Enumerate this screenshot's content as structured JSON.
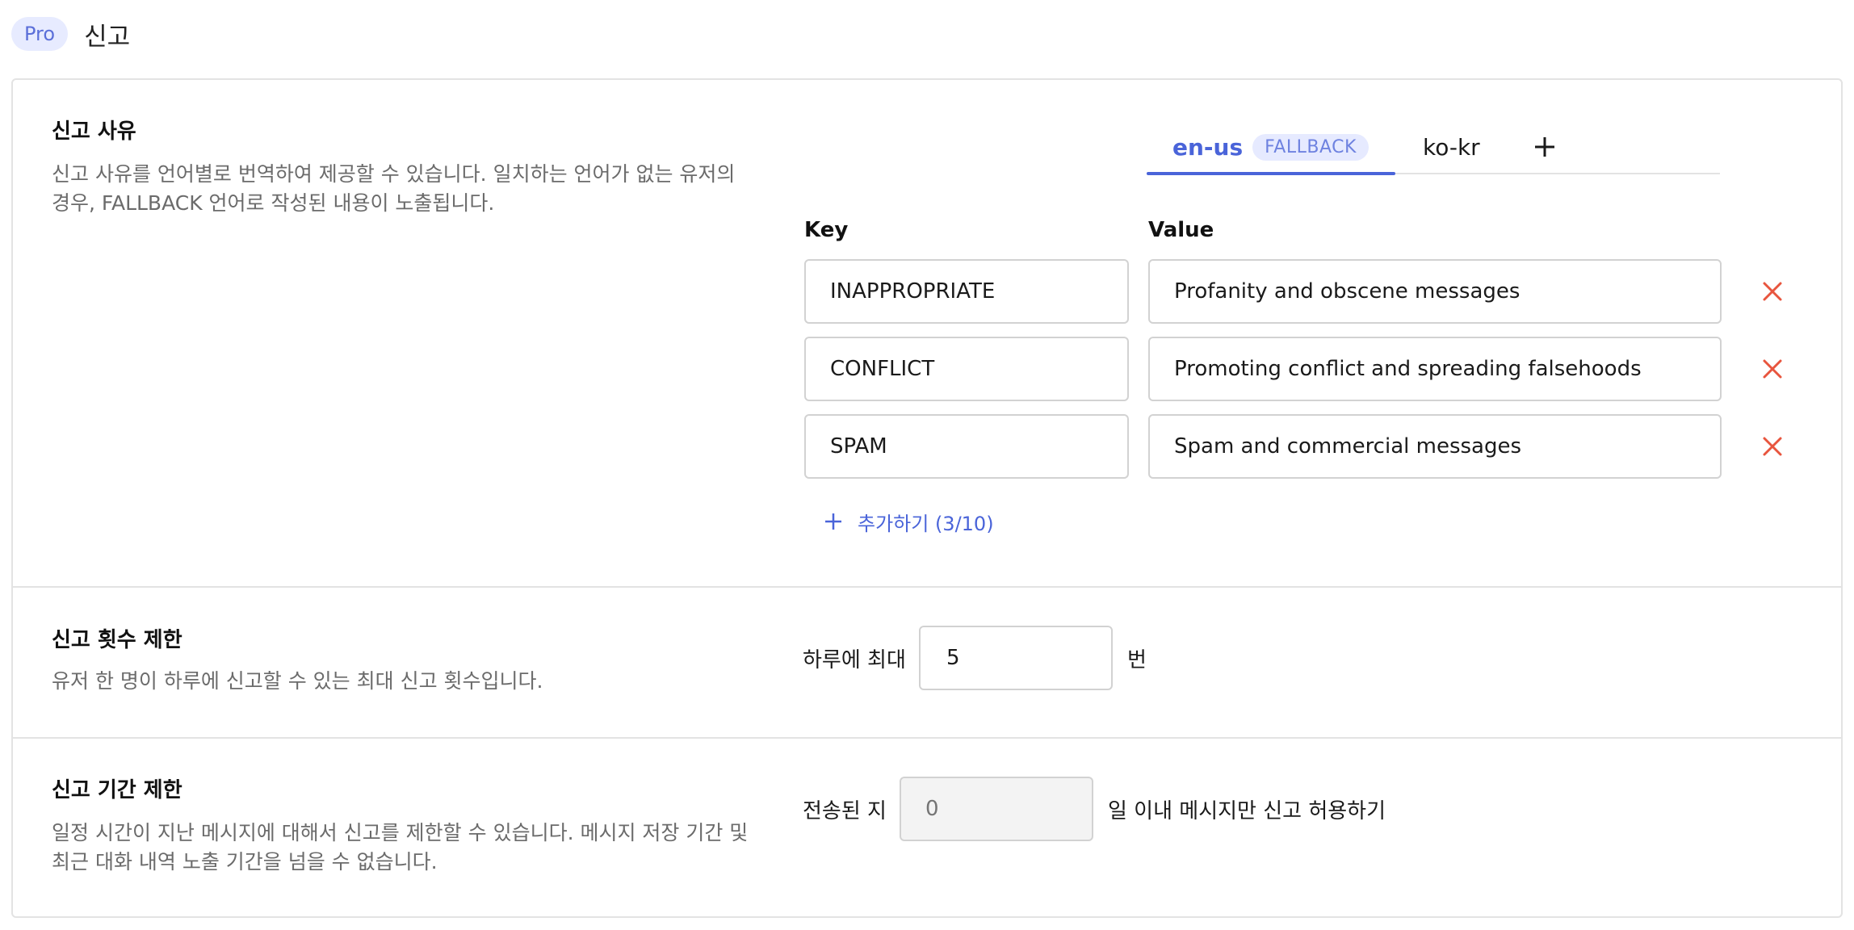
{
  "header": {
    "badge": "Pro",
    "title": "신고"
  },
  "reasons": {
    "title": "신고 사유",
    "description": "신고 사유를 언어별로 번역하여 제공할 수 있습니다. 일치하는 언어가 없는 유저의 경우, FALLBACK 언어로 작성된 내용이 노출됩니다.",
    "tabs": [
      {
        "label": "en-us",
        "badge": "FALLBACK",
        "active": true
      },
      {
        "label": "ko-kr",
        "active": false
      }
    ],
    "add_tab_icon": "plus-icon",
    "key_header": "Key",
    "value_header": "Value",
    "rows": [
      {
        "key": "INAPPROPRIATE",
        "value": "Profanity and obscene messages"
      },
      {
        "key": "CONFLICT",
        "value": "Promoting conflict and spreading falsehoods"
      },
      {
        "key": "SPAM",
        "value": "Spam and commercial messages"
      }
    ],
    "add_label": "추가하기 (3/10)",
    "delete_icon": "close-icon"
  },
  "count_limit": {
    "title": "신고 횟수 제한",
    "description": "유저 한 명이 하루에 신고할 수 있는 최대 신고 횟수입니다.",
    "prefix": "하루에 최대",
    "value": "5",
    "suffix": "번"
  },
  "period_limit": {
    "title": "신고 기간 제한",
    "description": "일정 시간이 지난 메시지에 대해서 신고를 제한할 수 있습니다. 메시지 저장 기간 및 최근 대화 내역 노출 기간을 넘을 수 없습니다.",
    "prefix": "전송된 지",
    "placeholder": "0",
    "suffix": "일 이내 메시지만 신고 허용하기"
  },
  "colors": {
    "accent": "#4a64d9",
    "danger": "#e8553e",
    "border": "#d2d2d2"
  }
}
